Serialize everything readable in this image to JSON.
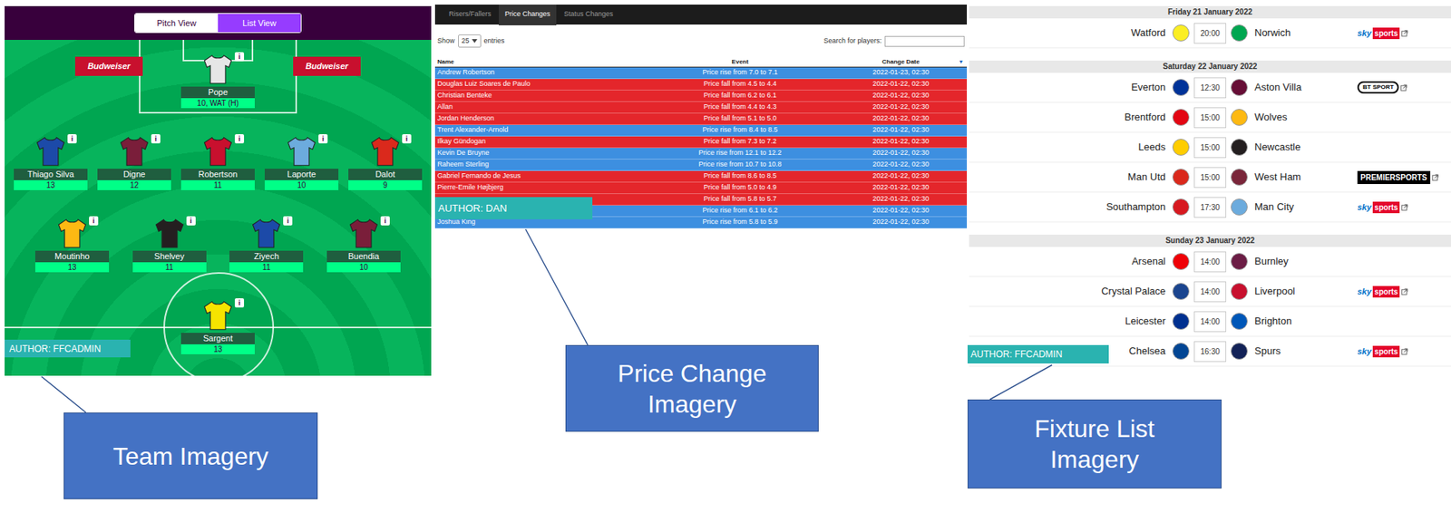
{
  "team_panel": {
    "tabs": [
      {
        "label": "Pitch View",
        "selected": true
      },
      {
        "label": "List View",
        "selected": false
      }
    ],
    "ads": [
      "Budweiser",
      "Budweiser"
    ],
    "info_glyph": "i",
    "lines": [
      [
        {
          "name": "Pope",
          "value": "10, WAT (H)",
          "color": "#e6e6e6"
        }
      ],
      [
        {
          "name": "Thiago Silva",
          "value": "13",
          "color": "#1c4aa8"
        },
        {
          "name": "Digne",
          "value": "12",
          "color": "#7a1e3a"
        },
        {
          "name": "Robertson",
          "value": "11",
          "color": "#c8102e"
        },
        {
          "name": "Laporte",
          "value": "10",
          "color": "#6cabdd"
        },
        {
          "name": "Dalot",
          "value": "9",
          "color": "#da291c"
        }
      ],
      [
        {
          "name": "Moutinho",
          "value": "13",
          "color": "#fdb913"
        },
        {
          "name": "Shelvey",
          "value": "11",
          "color": "#241f20"
        },
        {
          "name": "Ziyech",
          "value": "11",
          "color": "#1c4aa8"
        },
        {
          "name": "Buendia",
          "value": "10",
          "color": "#7a1e3a"
        }
      ],
      [
        {
          "name": "Sargent",
          "value": "13",
          "color": "#f5e400"
        }
      ]
    ],
    "author": "AUTHOR: FFCADMIN"
  },
  "price_panel": {
    "tabs": [
      {
        "label": "Risers/Fallers",
        "selected": false
      },
      {
        "label": "Price Changes",
        "selected": true
      },
      {
        "label": "Status Changes",
        "selected": false
      }
    ],
    "show_label": "Show",
    "page_size": "25",
    "entries_label": "entries",
    "search_label": "Search for players:",
    "columns": [
      {
        "label": "Name",
        "sort": ""
      },
      {
        "label": "Event",
        "sort": ""
      },
      {
        "label": "Change Date",
        "sort": "▼"
      }
    ],
    "rows": [
      {
        "name": "Andrew Robertson",
        "event": "Price rise from 7.0 to 7.1",
        "date": "2022-01-23, 02:30",
        "kind": "rise"
      },
      {
        "name": "Douglas Luiz Soares de Paulo",
        "event": "Price fall from 4.5 to 4.4",
        "date": "2022-01-22, 02:30",
        "kind": "fall"
      },
      {
        "name": "Christian Benteke",
        "event": "Price fall from 6.2 to 6.1",
        "date": "2022-01-22, 02:30",
        "kind": "fall"
      },
      {
        "name": "Allan",
        "event": "Price fall from 4.4 to 4.3",
        "date": "2022-01-22, 02:30",
        "kind": "fall"
      },
      {
        "name": "Jordan Henderson",
        "event": "Price fall from 5.1 to 5.0",
        "date": "2022-01-22, 02:30",
        "kind": "fall"
      },
      {
        "name": "Trent Alexander-Arnold",
        "event": "Price rise from 8.4 to 8.5",
        "date": "2022-01-22, 02:30",
        "kind": "rise"
      },
      {
        "name": "Ilkay Gündogan",
        "event": "Price fall from 7.3 to 7.2",
        "date": "2022-01-22, 02:30",
        "kind": "fall"
      },
      {
        "name": "Kevin De Bruyne",
        "event": "Price rise from 12.1 to 12.2",
        "date": "2022-01-22, 02:30",
        "kind": "rise"
      },
      {
        "name": "Raheem Sterling",
        "event": "Price rise from 10.7 to 10.8",
        "date": "2022-01-22, 02:30",
        "kind": "rise"
      },
      {
        "name": "Gabriel Fernando de Jesus",
        "event": "Price fall from 8.6 to 8.5",
        "date": "2022-01-22, 02:30",
        "kind": "fall"
      },
      {
        "name": "Pierre-Emile Højbjerg",
        "event": "Price fall from 5.0 to 4.9",
        "date": "2022-01-22, 02:30",
        "kind": "fall"
      },
      {
        "name": "",
        "event": "Price fall from 5.8 to 5.7",
        "date": "2022-01-22, 02:30",
        "kind": "fall"
      },
      {
        "name": "",
        "event": "Price rise from 6.1 to 6.2",
        "date": "2022-01-22, 02:30",
        "kind": "rise"
      },
      {
        "name": "Joshua King",
        "event": "Price rise from 5.8 to 5.9",
        "date": "2022-01-22, 02:30",
        "kind": "rise"
      }
    ],
    "author": "AUTHOR: DAN"
  },
  "fixture_panel": {
    "days": [
      {
        "date": "Friday 21 January 2022",
        "fixtures": [
          {
            "home": "Watford",
            "home_color": "#fbee23",
            "time": "20:00",
            "away": "Norwich",
            "away_color": "#00a650",
            "broadcaster": {
              "kind": "sky",
              "parts": [
                "sky",
                "sports"
              ]
            }
          }
        ]
      },
      {
        "date": "Saturday 22 January 2022",
        "fixtures": [
          {
            "home": "Everton",
            "home_color": "#003399",
            "time": "12:30",
            "away": "Aston Villa",
            "away_color": "#670e36",
            "broadcaster": {
              "kind": "bt",
              "parts": [
                "BT SPORT"
              ]
            }
          },
          {
            "home": "Brentford",
            "home_color": "#e30613",
            "time": "15:00",
            "away": "Wolves",
            "away_color": "#fdb913",
            "broadcaster": {
              "kind": "none",
              "parts": []
            }
          },
          {
            "home": "Leeds",
            "home_color": "#ffcd00",
            "time": "15:00",
            "away": "Newcastle",
            "away_color": "#241f20",
            "broadcaster": {
              "kind": "none",
              "parts": []
            }
          },
          {
            "home": "Man Utd",
            "home_color": "#da291c",
            "time": "15:00",
            "away": "West Ham",
            "away_color": "#7a263a",
            "broadcaster": {
              "kind": "premier",
              "parts": [
                "PREMIERSPORTS"
              ]
            }
          },
          {
            "home": "Southampton",
            "home_color": "#d71920",
            "time": "17:30",
            "away": "Man City",
            "away_color": "#6cabdd",
            "broadcaster": {
              "kind": "sky",
              "parts": [
                "sky",
                "sports"
              ]
            }
          }
        ]
      },
      {
        "date": "Sunday 23 January 2022",
        "fixtures": [
          {
            "home": "Arsenal",
            "home_color": "#ef0107",
            "time": "14:00",
            "away": "Burnley",
            "away_color": "#6c1d45",
            "broadcaster": {
              "kind": "none",
              "parts": []
            }
          },
          {
            "home": "Crystal Palace",
            "home_color": "#1b458f",
            "time": "14:00",
            "away": "Liverpool",
            "away_color": "#c8102e",
            "broadcaster": {
              "kind": "sky",
              "parts": [
                "sky",
                "sports"
              ]
            }
          },
          {
            "home": "Leicester",
            "home_color": "#003090",
            "time": "14:00",
            "away": "Brighton",
            "away_color": "#0057b8",
            "broadcaster": {
              "kind": "none",
              "parts": []
            }
          },
          {
            "home": "Chelsea",
            "home_color": "#034694",
            "time": "16:30",
            "away": "Spurs",
            "away_color": "#132257",
            "broadcaster": {
              "kind": "sky",
              "parts": [
                "sky",
                "sports"
              ]
            }
          }
        ]
      }
    ],
    "author": "AUTHOR: FFCADMIN"
  },
  "callouts": [
    {
      "text": "Team Imagery"
    },
    {
      "text": "Price Change Imagery"
    },
    {
      "text": "Fixture List Imagery"
    }
  ]
}
